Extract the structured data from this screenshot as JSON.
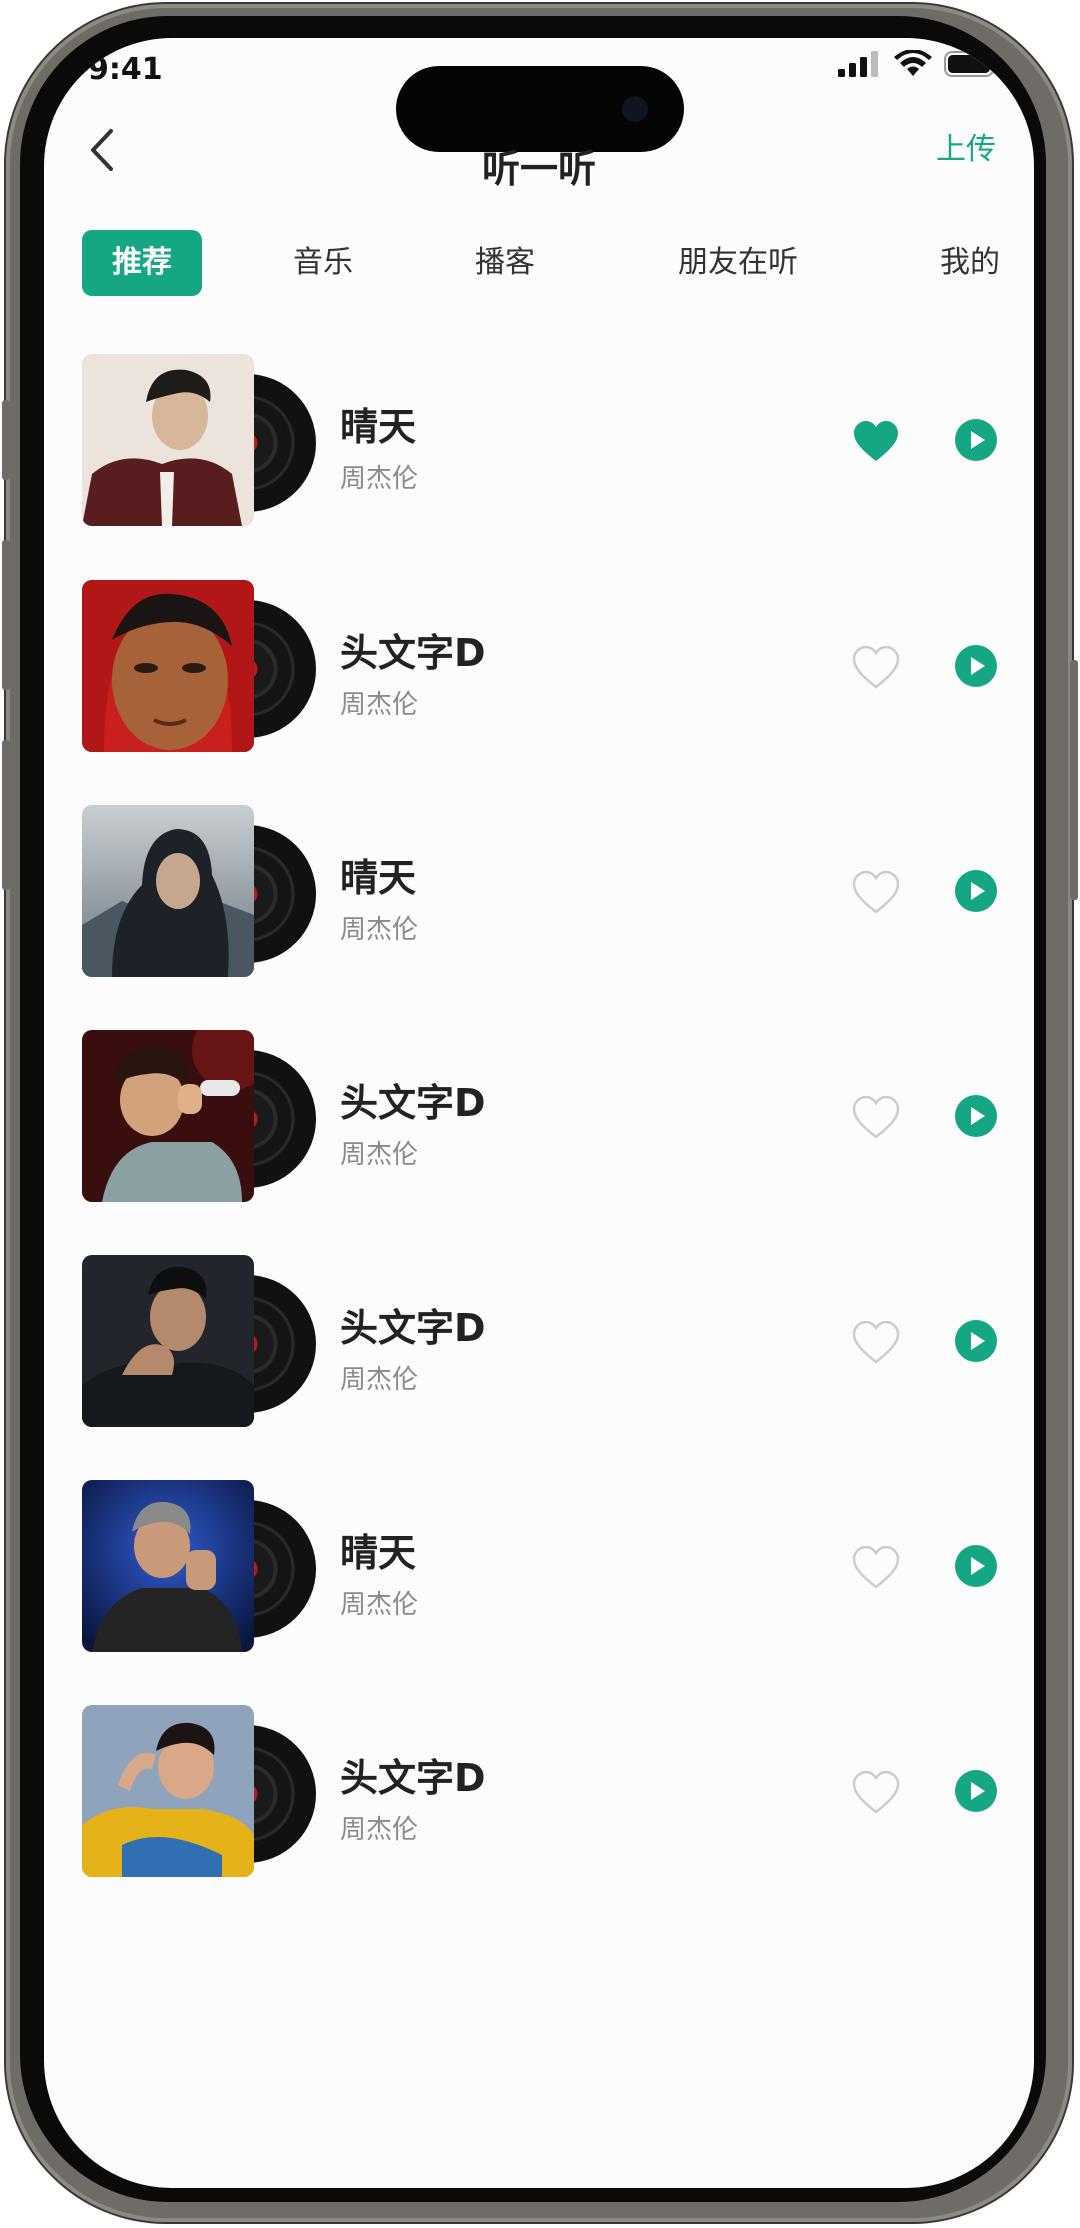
{
  "status_bar": {
    "time": "9:41"
  },
  "header": {
    "title": "听一听",
    "upload_label": "上传"
  },
  "tabs": [
    {
      "label": "推荐",
      "active": true
    },
    {
      "label": "音乐",
      "active": false
    },
    {
      "label": "播客",
      "active": false
    },
    {
      "label": "朋友在听",
      "active": false
    },
    {
      "label": "我的",
      "active": false
    }
  ],
  "songs": [
    {
      "title": "晴天",
      "artist": "周杰伦",
      "liked": true
    },
    {
      "title": "头文字D",
      "artist": "周杰伦",
      "liked": false
    },
    {
      "title": "晴天",
      "artist": "周杰伦",
      "liked": false
    },
    {
      "title": "头文字D",
      "artist": "周杰伦",
      "liked": false
    },
    {
      "title": "头文字D",
      "artist": "周杰伦",
      "liked": false
    },
    {
      "title": "晴天",
      "artist": "周杰伦",
      "liked": false
    },
    {
      "title": "头文字D",
      "artist": "周杰伦",
      "liked": false
    }
  ],
  "colors": {
    "accent": "#15a784",
    "title_text": "#222222",
    "secondary_text": "#8a8a8a",
    "heart_outline": "#cccccc"
  },
  "icons": [
    "back-chevron-icon",
    "heart-icon",
    "play-icon",
    "vinyl-record-icon",
    "signal-icon",
    "wifi-icon",
    "battery-icon"
  ]
}
